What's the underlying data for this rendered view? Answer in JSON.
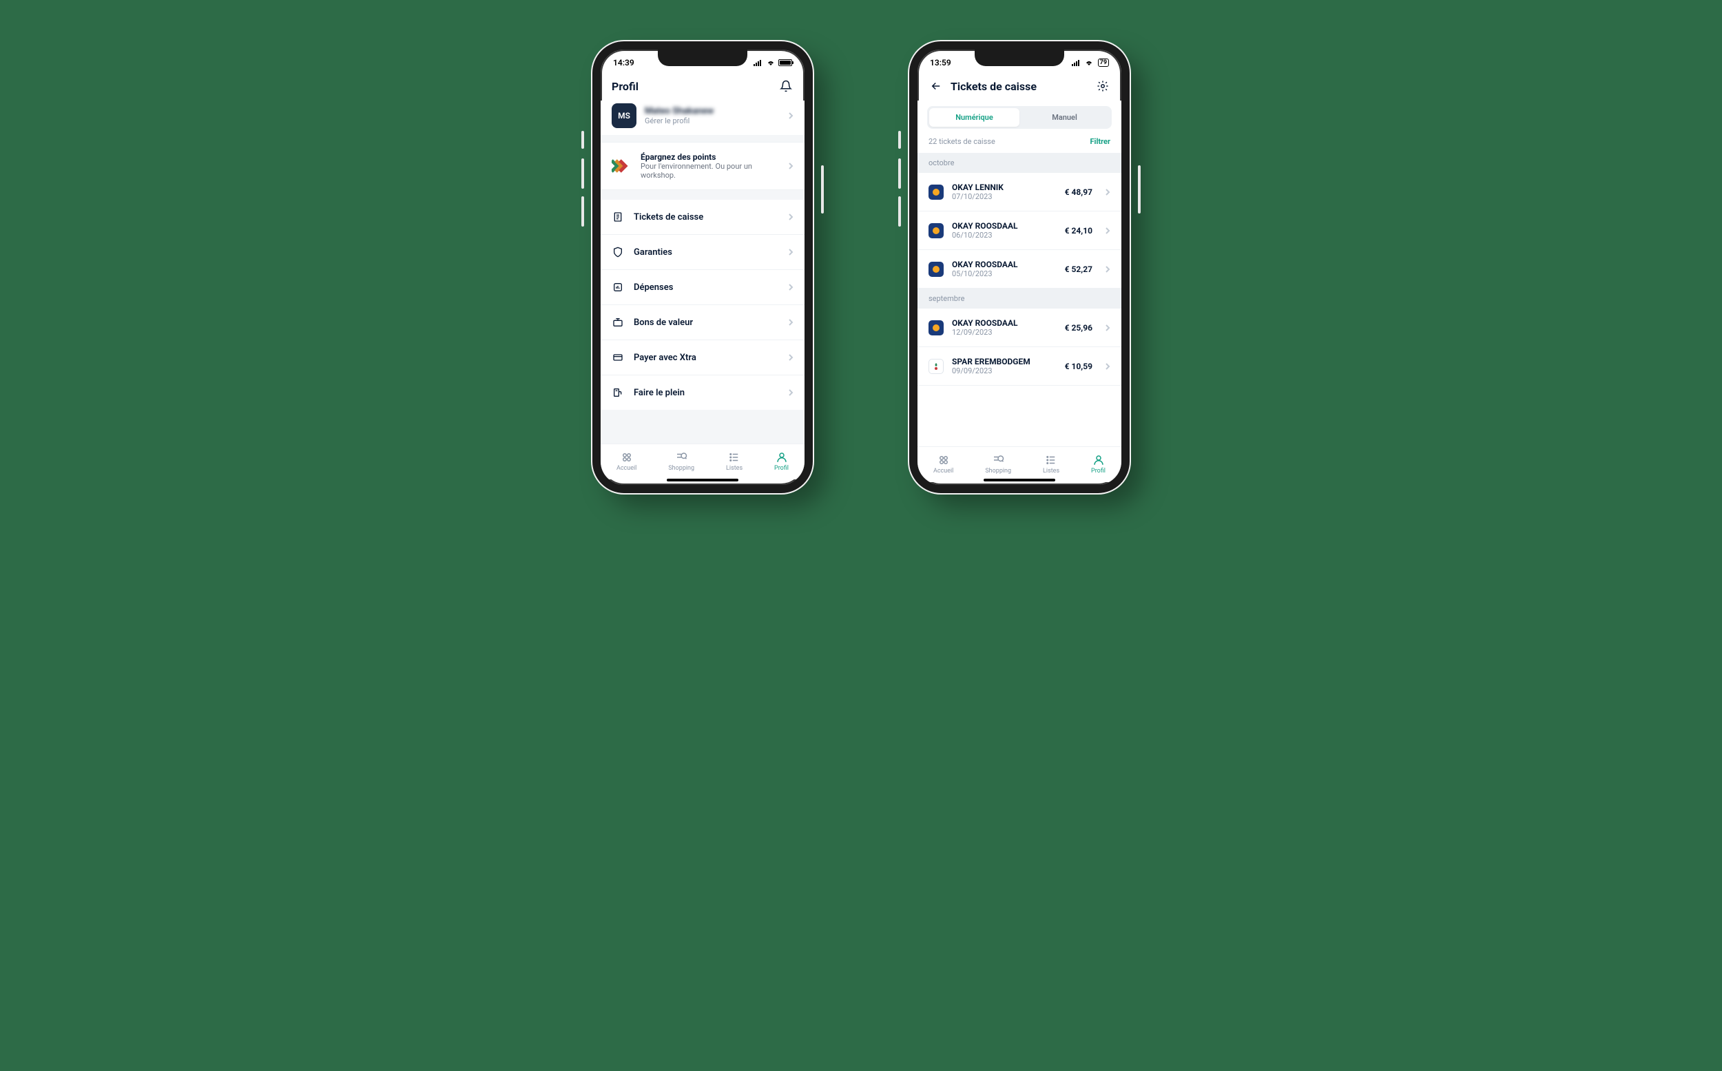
{
  "colors": {
    "accent": "#14a085",
    "bg": "#2d6b47",
    "text_primary": "#0a1a33",
    "text_secondary": "#8a95a5"
  },
  "phone1": {
    "status": {
      "time": "14:39",
      "battery_pct": 100
    },
    "header": {
      "title": "Profil"
    },
    "profile": {
      "initials": "MS",
      "name": "Mateo Shakanew",
      "manage": "Gérer le profil"
    },
    "points": {
      "title": "Épargnez des points",
      "subtitle": "Pour l'environnement. Ou pour un workshop."
    },
    "menu": [
      {
        "icon": "receipt-icon",
        "label": "Tickets de caisse"
      },
      {
        "icon": "shield-icon",
        "label": "Garanties"
      },
      {
        "icon": "chart-icon",
        "label": "Dépenses"
      },
      {
        "icon": "voucher-icon",
        "label": "Bons de valeur"
      },
      {
        "icon": "card-icon",
        "label": "Payer avec Xtra"
      },
      {
        "icon": "fuel-icon",
        "label": "Faire le plein"
      }
    ]
  },
  "phone2": {
    "status": {
      "time": "13:59",
      "battery_pct": 79,
      "battery_label": "79"
    },
    "header": {
      "title": "Tickets de caisse"
    },
    "segments": {
      "digital": "Numérique",
      "manual": "Manuel"
    },
    "filter": {
      "count": "22 tickets de caisse",
      "label": "Filtrer"
    },
    "sections": [
      {
        "title": "octobre",
        "items": [
          {
            "logo": "okay",
            "name": "OKAY LENNIK",
            "date": "07/10/2023",
            "amount": "€ 48,97"
          },
          {
            "logo": "okay",
            "name": "OKAY ROOSDAAL",
            "date": "06/10/2023",
            "amount": "€ 24,10"
          },
          {
            "logo": "okay",
            "name": "OKAY ROOSDAAL",
            "date": "05/10/2023",
            "amount": "€ 52,27"
          }
        ]
      },
      {
        "title": "septembre",
        "items": [
          {
            "logo": "okay",
            "name": "OKAY ROOSDAAL",
            "date": "12/09/2023",
            "amount": "€ 25,96"
          },
          {
            "logo": "spar",
            "name": "SPAR EREMBODGEM",
            "date": "09/09/2023",
            "amount": "€ 10,59"
          }
        ]
      }
    ]
  },
  "tabs": [
    {
      "icon": "home-icon",
      "label": "Accueil"
    },
    {
      "icon": "shopping-icon",
      "label": "Shopping"
    },
    {
      "icon": "list-icon",
      "label": "Listes"
    },
    {
      "icon": "profile-icon",
      "label": "Profil"
    }
  ]
}
